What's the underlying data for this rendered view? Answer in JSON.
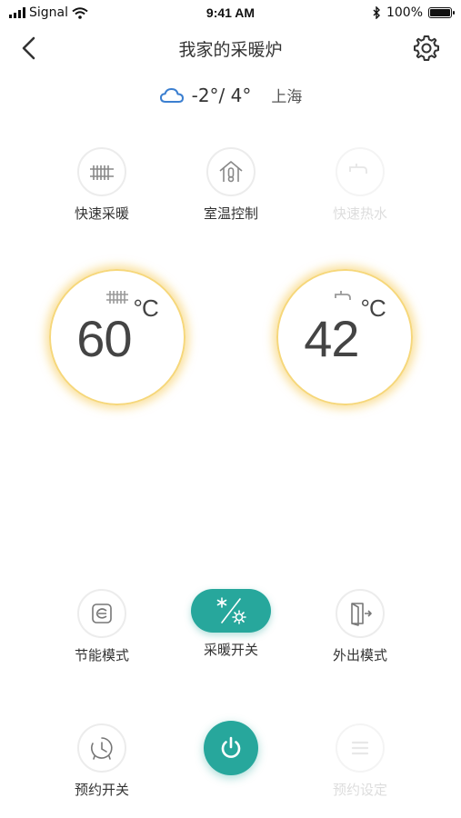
{
  "status_bar": {
    "carrier": "Signal",
    "time": "9:41 AM",
    "battery": "100%"
  },
  "nav": {
    "title": "我家的采暖炉"
  },
  "weather": {
    "temp_range": "-2°/ 4°",
    "city": "上海",
    "icon": "cloud-icon"
  },
  "top_functions": [
    {
      "label": "快速采暖",
      "icon": "radiator-icon"
    },
    {
      "label": "室温控制",
      "icon": "house-thermometer-icon"
    },
    {
      "label": "快速热水",
      "icon": "faucet-icon"
    }
  ],
  "dials": {
    "heating": {
      "value": "60",
      "unit": "°C",
      "icon": "radiator-icon"
    },
    "hot_water": {
      "value": "42",
      "unit": "°C",
      "icon": "faucet-icon"
    }
  },
  "bottom_functions": [
    {
      "label": "节能模式",
      "icon": "eco-icon"
    },
    {
      "label": "采暖开关",
      "icon": "snow-sun-toggle-icon"
    },
    {
      "label": "外出模式",
      "icon": "exit-door-icon"
    },
    {
      "label": "预约开关",
      "icon": "timer-icon"
    },
    {
      "label": "电源",
      "icon": "power-icon"
    },
    {
      "label": "预约设定",
      "icon": "menu-icon"
    }
  ],
  "colors": {
    "accent": "#27a79c",
    "dial_glow": "#f6d77a",
    "weather_icon": "#3b7fd0"
  }
}
